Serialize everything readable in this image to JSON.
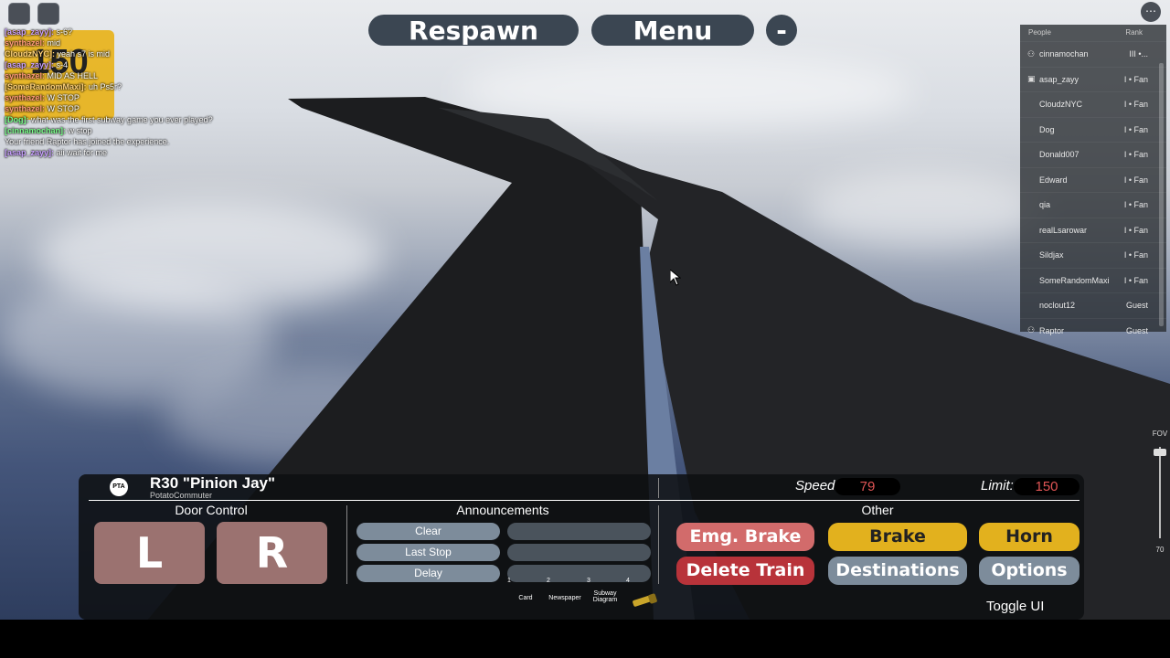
{
  "top_buttons": {
    "respawn": "Respawn",
    "menu": "Menu",
    "minimize": "-"
  },
  "chat": [
    {
      "name": "[asap_zayy]:",
      "msg": "s-6?",
      "color": "#c8a0ff"
    },
    {
      "name": "synthazel:",
      "msg": "mid",
      "color": "#ff9a7a"
    },
    {
      "name": "CloudzNYC]:",
      "msg": "yeah s7 is mid",
      "color": "#ffd27a"
    },
    {
      "name": "[asap_zayy]:",
      "msg": "s-4",
      "color": "#c8a0ff"
    },
    {
      "name": "synthazel:",
      "msg": "MID AS HELL",
      "color": "#ff9a7a"
    },
    {
      "name": "[SomeRandomMaxi]:",
      "msg": "uh Ps5r?",
      "color": "#ffd27a"
    },
    {
      "name": "synthazel:",
      "msg": "W STOP",
      "color": "#ff9a7a"
    },
    {
      "name": "synthazel:",
      "msg": "W STOP",
      "color": "#ff9a7a"
    },
    {
      "name": "[Dog]:",
      "msg": "what was the first subway game you ever played?",
      "color": "#7aff8a"
    },
    {
      "name": "[cinnamochan]:",
      "msg": "w stop",
      "color": "#7aff8a"
    },
    {
      "name": "",
      "msg": "Your friend Raptor has joined the experience.",
      "color": "#ffffff"
    },
    {
      "name": "[asap_zayy]:",
      "msg": "aii wait for me",
      "color": "#c8a0ff"
    }
  ],
  "badge_text": "150",
  "player_list": {
    "header_people": "People",
    "header_rank": "Rank",
    "players": [
      {
        "name": "cinnamochan",
        "rank": "III •...",
        "icon": "friends-icon"
      },
      {
        "name": "asap_zayy",
        "rank": "I • Fan",
        "icon": "premium-icon"
      },
      {
        "name": "CloudzNYC",
        "rank": "I • Fan",
        "icon": ""
      },
      {
        "name": "Dog",
        "rank": "I • Fan",
        "icon": ""
      },
      {
        "name": "Donald007",
        "rank": "I • Fan",
        "icon": ""
      },
      {
        "name": "Edward",
        "rank": "I • Fan",
        "icon": ""
      },
      {
        "name": "qia",
        "rank": "I • Fan",
        "icon": ""
      },
      {
        "name": "realLsarowar",
        "rank": "I • Fan",
        "icon": ""
      },
      {
        "name": "Sildjax",
        "rank": "I • Fan",
        "icon": ""
      },
      {
        "name": "SomeRandomMaxi",
        "rank": "I • Fan",
        "icon": ""
      },
      {
        "name": "noclout12",
        "rank": "Guest",
        "icon": ""
      },
      {
        "name": "Raptor",
        "rank": "Guest",
        "icon": "friends-icon"
      }
    ]
  },
  "fov": {
    "label": "FOV",
    "value": "70"
  },
  "train": {
    "logo": "PTA",
    "title": "R30 \"Pinion Jay\"",
    "subtitle": "PotatoCommuter",
    "speed_label": "Speed:",
    "speed_value": "79",
    "limit_label": "Limit:",
    "limit_value": "150"
  },
  "sections": {
    "door": "Door Control",
    "announcements": "Announcements",
    "other": "Other"
  },
  "doors": {
    "left": "L",
    "right": "R"
  },
  "announcements": [
    "Clear",
    "Last Stop",
    "Delay"
  ],
  "other_buttons": {
    "emg_brake": "Emg. Brake",
    "brake": "Brake",
    "horn": "Horn",
    "delete_train": "Delete Train",
    "destinations": "Destinations",
    "options": "Options"
  },
  "hotbar": [
    {
      "num": "1",
      "label": "Card"
    },
    {
      "num": "2",
      "label": "Newspaper"
    },
    {
      "num": "3",
      "label": "Subway Diagram"
    },
    {
      "num": "4",
      "label": ""
    }
  ],
  "toggle_ui": "Toggle UI",
  "colors": {
    "door_button": "#9b7270",
    "emg_brake": "#d26b6b",
    "brake_horn": "#e2b11e",
    "delete_train": "#b8333a",
    "neutral_button": "#7d8c9b",
    "speed_text": "#e05555"
  }
}
